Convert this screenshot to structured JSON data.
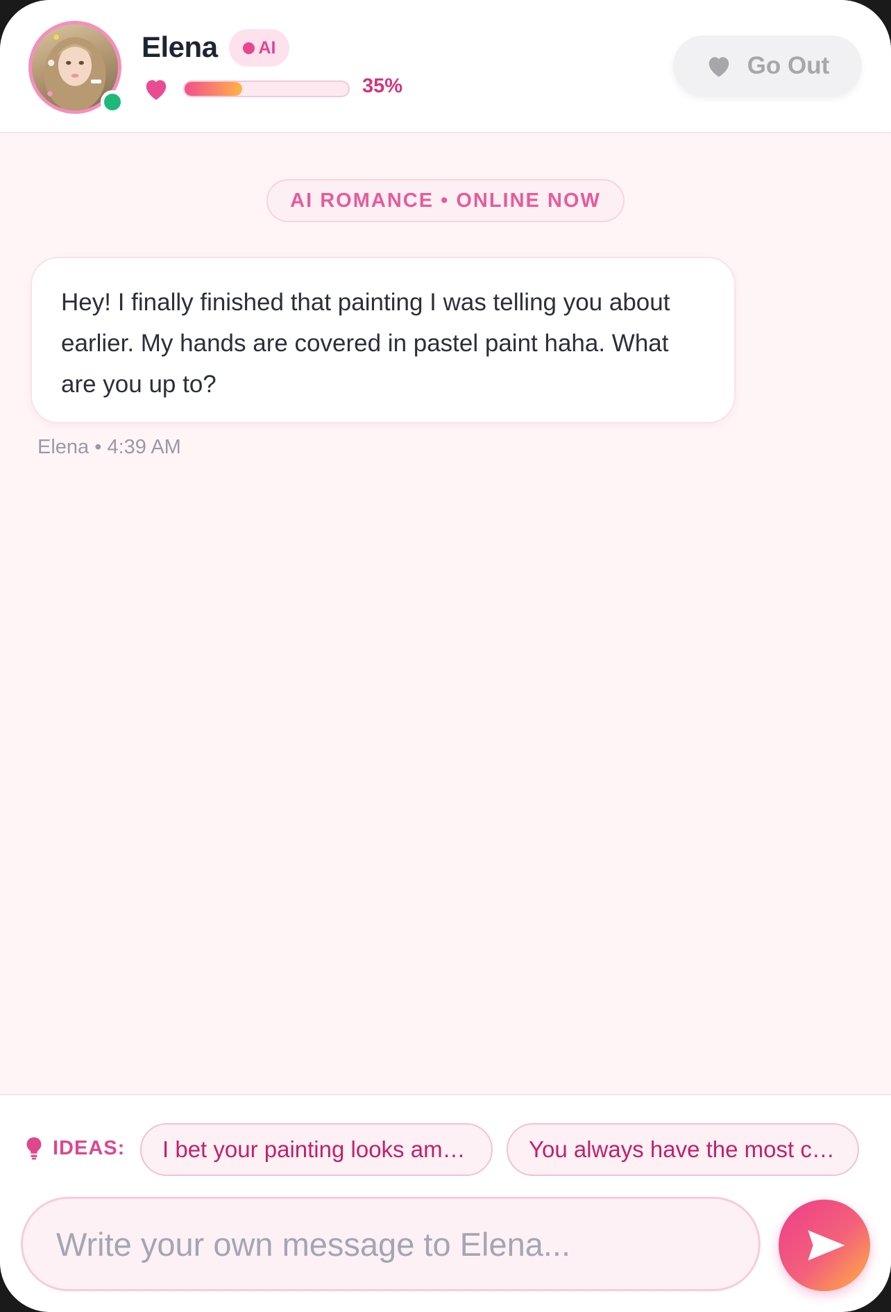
{
  "colors": {
    "accent_pink": "#e0468d",
    "online_green": "#1db97a",
    "background": "#fff5f7",
    "send_gradient": [
      "#ec3d8a",
      "#ffb23e"
    ]
  },
  "header": {
    "name": "Elena",
    "ai_badge": "AI",
    "affection_percent_label": "35%",
    "affection_value": 0.35,
    "go_out_label": "Go Out",
    "avatar_icon": "profile-photo",
    "heart_icon": "heart-icon"
  },
  "status_pill": "AI ROMANCE • ONLINE NOW",
  "messages": [
    {
      "text": "Hey! I finally finished that painting I was telling you about earlier. My hands are covered in pastel paint haha. What are you up to?",
      "meta": "Elena • 4:39 AM"
    }
  ],
  "ideas": {
    "label": "IDEAS:",
    "chips": [
      "I bet your painting looks am…",
      "You always have the most c…"
    ]
  },
  "composer": {
    "placeholder": "Write your own message to Elena...",
    "value": ""
  }
}
